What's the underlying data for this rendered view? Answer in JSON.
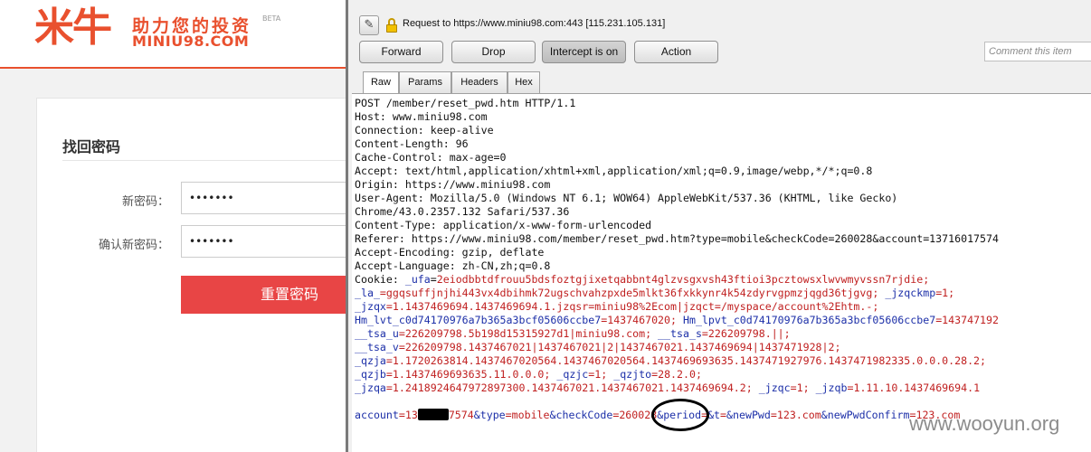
{
  "site": {
    "logo_mark": "米牛",
    "slogan": "助力您的投资",
    "beta": "BETA",
    "domain": "MINIU98.COM",
    "form_title": "找回密码",
    "new_pwd_label": "新密码：",
    "new_pwd_value": "•••••••",
    "confirm_pwd_label": "确认新密码：",
    "confirm_pwd_value": "•••••••",
    "reset_button": "重置密码",
    "accent_color": "#e9502e",
    "button_color": "#e84545"
  },
  "burp": {
    "request_target": "Request to https://www.miniu98.com:443  [115.231.105.131]",
    "buttons": {
      "forward": "Forward",
      "drop": "Drop",
      "intercept": "Intercept is on",
      "action": "Action"
    },
    "comment_placeholder": "Comment this item",
    "tabs": [
      "Raw",
      "Params",
      "Headers",
      "Hex"
    ],
    "request_lines": [
      "POST /member/reset_pwd.htm HTTP/1.1",
      "Host: www.miniu98.com",
      "Connection: keep-alive",
      "Content-Length: 96",
      "Cache-Control: max-age=0",
      "Accept: text/html,application/xhtml+xml,application/xml;q=0.9,image/webp,*/*;q=0.8",
      "Origin: https://www.miniu98.com",
      "User-Agent: Mozilla/5.0 (Windows NT 6.1; WOW64) AppleWebKit/537.36 (KHTML, like Gecko)",
      "Chrome/43.0.2357.132 Safari/537.36",
      "Content-Type: application/x-www-form-urlencoded",
      "Referer: https://www.miniu98.com/member/reset_pwd.htm?type=mobile&checkCode=260028&account=13716017574",
      "Accept-Encoding: gzip, deflate",
      "Accept-Language: zh-CN,zh;q=0.8"
    ],
    "cookie_lines": [
      [
        {
          "t": "Cookie: ",
          "k": "h"
        },
        {
          "t": "_ufa",
          "k": "k"
        },
        {
          "t": "=",
          "k": "h"
        },
        {
          "t": "2eiodbbtdfrouu5bdsfoztgjixetqabbnt4glzvsgxvsh43ftioi3pcztowsxlwvwmyvssn7rjdie;",
          "k": "v"
        }
      ],
      [
        {
          "t": "_la_",
          "k": "k"
        },
        {
          "t": "=ggqsuffjnjhi443vx4dbihmk72ugschvahzpxde5mlkt36fxkkynr4k54zdyrvgpmzjqgd36tjgvg;",
          "k": "v"
        },
        {
          "t": " _jzqckmp",
          "k": "k"
        },
        {
          "t": "=1;",
          "k": "v"
        }
      ],
      [
        {
          "t": "_jzqx",
          "k": "k"
        },
        {
          "t": "=1.1437469694.1437469694.1.jzqsr=miniu98%2Ecom|jzqct=/myspace/account%2Ehtm.-;",
          "k": "v"
        }
      ],
      [
        {
          "t": "Hm_lvt_c0d74170976a7b365a3bcf05606ccbe7",
          "k": "k"
        },
        {
          "t": "=1437467020;",
          "k": "v"
        },
        {
          "t": " Hm_lpvt_c0d74170976a7b365a3bcf05606ccbe7",
          "k": "k"
        },
        {
          "t": "=143747192",
          "k": "v"
        }
      ],
      [
        {
          "t": "__tsa_u",
          "k": "k"
        },
        {
          "t": "=226209798.5b198d15315927d1|miniu98.com;",
          "k": "v"
        },
        {
          "t": " __tsa_s",
          "k": "k"
        },
        {
          "t": "=226209798.||;",
          "k": "v"
        }
      ],
      [
        {
          "t": "__tsa_v",
          "k": "k"
        },
        {
          "t": "=226209798.1437467021|1437467021|2|1437467021.1437469694|1437471928|2;",
          "k": "v"
        }
      ],
      [
        {
          "t": "_qzja",
          "k": "k"
        },
        {
          "t": "=1.1720263814.1437467020564.1437467020564.1437469693635.1437471927976.1437471982335.0.0.0.28.2;",
          "k": "v"
        }
      ],
      [
        {
          "t": "_qzjb",
          "k": "k"
        },
        {
          "t": "=1.1437469693635.11.0.0.0;",
          "k": "v"
        },
        {
          "t": " _qzjc",
          "k": "k"
        },
        {
          "t": "=1;",
          "k": "v"
        },
        {
          "t": " _qzjto",
          "k": "k"
        },
        {
          "t": "=28.2.0;",
          "k": "v"
        }
      ],
      [
        {
          "t": "_jzqa",
          "k": "k"
        },
        {
          "t": "=1.2418924647972897300.1437467021.1437467021.1437469694.2;",
          "k": "v"
        },
        {
          "t": " _jzqc",
          "k": "k"
        },
        {
          "t": "=1;",
          "k": "v"
        },
        {
          "t": " _jzqb",
          "k": "k"
        },
        {
          "t": "=1.11.10.1437469694.1",
          "k": "v"
        }
      ]
    ],
    "body_parts": [
      {
        "t": "account",
        "k": "k"
      },
      {
        "t": "=13",
        "k": "v"
      },
      {
        "t": "",
        "k": "redact"
      },
      {
        "t": "7574",
        "k": "v"
      },
      {
        "t": "&type",
        "k": "k"
      },
      {
        "t": "=mobile",
        "k": "v"
      },
      {
        "t": "&checkCode",
        "k": "k"
      },
      {
        "t": "=260028",
        "k": "v"
      },
      {
        "t": "&period",
        "k": "k"
      },
      {
        "t": "=",
        "k": "v"
      },
      {
        "t": "&t",
        "k": "k"
      },
      {
        "t": "=",
        "k": "v"
      },
      {
        "t": "&newPwd",
        "k": "k"
      },
      {
        "t": "=123.com",
        "k": "v"
      },
      {
        "t": "&newPwdConfirm",
        "k": "k"
      },
      {
        "t": "=123.com",
        "k": "v"
      }
    ],
    "watermark": "www.wooyun.org"
  }
}
